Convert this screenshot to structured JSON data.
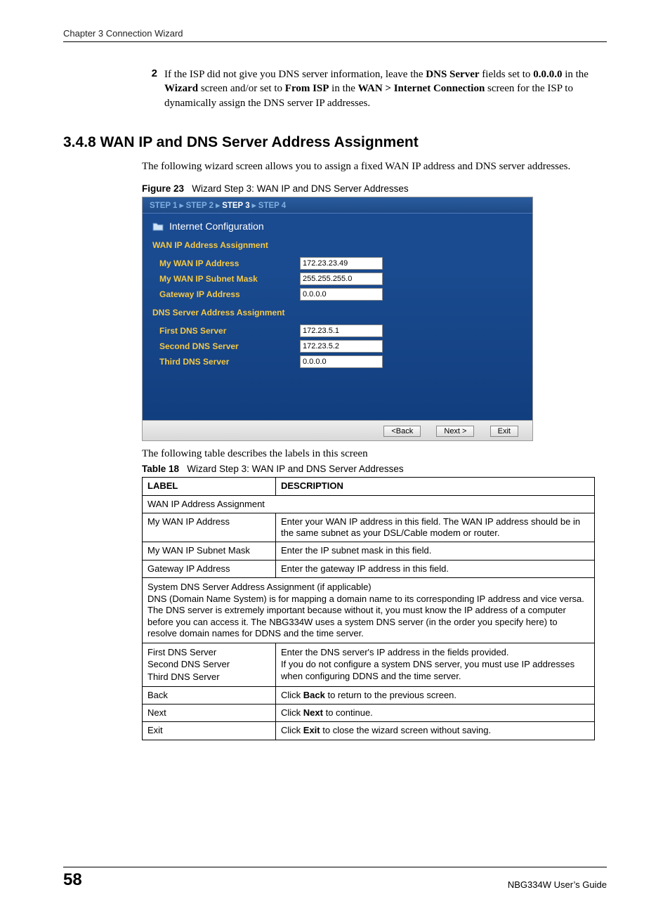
{
  "header": {
    "chapter": "Chapter 3 Connection Wizard"
  },
  "numbered": {
    "num": "2",
    "text_parts": {
      "a": "If the ISP did not give you DNS server information, leave the ",
      "b": "DNS Server",
      "c": " fields set to ",
      "d": "0.0.0.0",
      "e": " in the ",
      "f": "Wizard",
      "g": " screen and/or set to ",
      "h": "From ISP",
      "i": " in the ",
      "j": "WAN > Internet Connection",
      "k": " screen for the ISP to dynamically assign the DNS server IP addresses."
    }
  },
  "section": {
    "heading": "3.4.8  WAN IP and DNS Server Address Assignment"
  },
  "intro": "The following wizard screen allows you to assign a fixed WAN IP address and DNS server addresses.",
  "figure": {
    "label": "Figure 23",
    "caption": "Wizard Step 3: WAN IP and DNS Server Addresses"
  },
  "wizard": {
    "steps": {
      "s1": "STEP 1",
      "s2": "STEP 2",
      "s3": "STEP 3",
      "s4": "STEP 4",
      "sep": " ▸ "
    },
    "title": "Internet Configuration",
    "section1": "WAN IP Address Assignment",
    "rows1": {
      "r1": {
        "label": "My WAN IP Address",
        "value": "172.23.23.49"
      },
      "r2": {
        "label": "My WAN IP Subnet Mask",
        "value": "255.255.255.0"
      },
      "r3": {
        "label": "Gateway IP Address",
        "value": "0.0.0.0"
      }
    },
    "section2": "DNS Server Address Assignment",
    "rows2": {
      "r1": {
        "label": "First DNS Server",
        "value": "172.23.5.1"
      },
      "r2": {
        "label": "Second DNS Server",
        "value": "172.23.5.2"
      },
      "r3": {
        "label": "Third DNS Server",
        "value": "0.0.0.0"
      }
    },
    "buttons": {
      "back": "<Back",
      "next": "Next >",
      "exit": "Exit"
    }
  },
  "after_fig": "The following table describes the labels in this screen",
  "table_caption": {
    "label": "Table 18",
    "caption": "Wizard Step 3: WAN IP and DNS Server Addresses"
  },
  "table": {
    "head": {
      "c1": "LABEL",
      "c2": "DESCRIPTION"
    },
    "row_span1": "WAN IP Address Assignment",
    "rows_a": {
      "r1": {
        "l": "My WAN IP Address",
        "d": "Enter your WAN IP address in this field. The WAN IP address should be in the same subnet as your DSL/Cable modem or router."
      },
      "r2": {
        "l": "My WAN IP Subnet Mask",
        "d": "Enter the IP subnet mask in this field."
      },
      "r3": {
        "l": "Gateway IP Address",
        "d": "Enter the gateway IP address in this field."
      }
    },
    "row_span2a": "System DNS Server Address Assignment (if applicable)",
    "row_span2b": "DNS (Domain Name System) is for mapping a domain name to its corresponding IP address and vice versa. The DNS server is extremely important because without it, you must know the IP address of a computer before you can access it. The NBG334W uses a system DNS server (in the order you specify here) to resolve domain names for DDNS and the time server.",
    "rows_b": {
      "r1": {
        "l1": "First DNS Server",
        "l2": "Second DNS Server",
        "l3": "Third DNS Server",
        "d1": "Enter the DNS server's IP address in the fields provided.",
        "d2": "If you do not configure a system DNS server, you must use IP addresses when configuring DDNS and the time server."
      },
      "r2": {
        "l": "Back",
        "d_a": "Click ",
        "d_b": "Back",
        "d_c": " to return to the previous screen."
      },
      "r3": {
        "l": "Next",
        "d_a": "Click ",
        "d_b": "Next",
        "d_c": " to continue."
      },
      "r4": {
        "l": "Exit",
        "d_a": "Click ",
        "d_b": "Exit",
        "d_c": " to close the wizard screen without saving."
      }
    }
  },
  "footer": {
    "page": "58",
    "guide": "NBG334W User’s Guide"
  }
}
